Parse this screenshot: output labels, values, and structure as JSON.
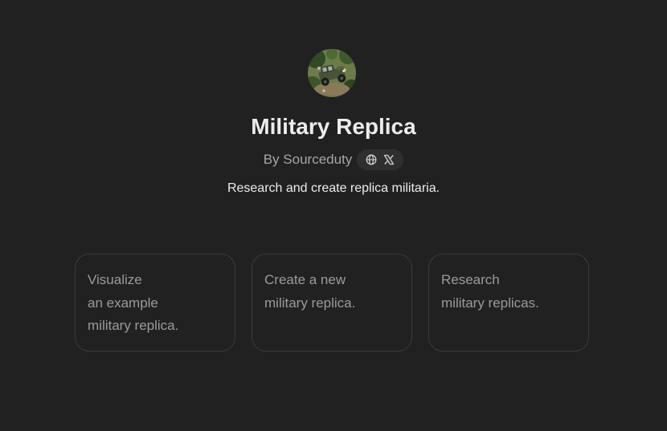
{
  "gpt": {
    "avatar_icon": "jeep-in-forest-avatar-icon",
    "title": "Military Replica",
    "author": "By Sourceduty",
    "links": [
      {
        "icon": "globe-icon"
      },
      {
        "icon": "x-logo-icon"
      }
    ],
    "description": "Research and create replica militaria."
  },
  "starters": [
    {
      "text": "Visualize\nan example\nmilitary replica."
    },
    {
      "text": "Create a new\nmilitary replica."
    },
    {
      "text": "Research\nmilitary replicas."
    }
  ],
  "colors": {
    "background": "#212121",
    "title": "#ececec",
    "muted_text": "#9b9b9b",
    "card_border": "#3b3b3b",
    "pill_background": "#2f2f2f"
  }
}
